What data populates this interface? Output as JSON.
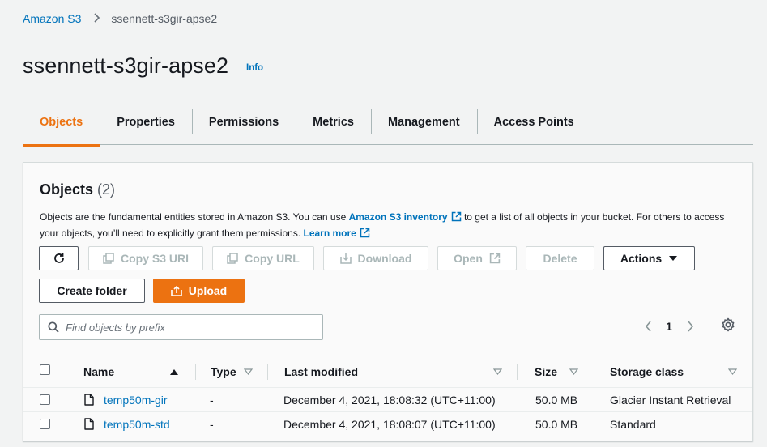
{
  "breadcrumb": {
    "root": "Amazon S3",
    "separator": ">",
    "current": "ssennett-s3gir-apse2"
  },
  "page": {
    "title": "ssennett-s3gir-apse2",
    "info_label": "Info"
  },
  "tabs": [
    {
      "label": "Objects",
      "active": true
    },
    {
      "label": "Properties",
      "active": false
    },
    {
      "label": "Permissions",
      "active": false
    },
    {
      "label": "Metrics",
      "active": false
    },
    {
      "label": "Management",
      "active": false
    },
    {
      "label": "Access Points",
      "active": false
    }
  ],
  "objects_panel": {
    "title": "Objects",
    "count": "(2)",
    "desc_part1": "Objects are the fundamental entities stored in Amazon S3. You can use ",
    "inventory_link": "Amazon S3 inventory",
    "desc_part2": " to get a list of all objects in your bucket. For others to access your objects, you’ll need to explicitly grant them permissions. ",
    "learn_more_link": "Learn more"
  },
  "toolbar": {
    "copy_s3_uri": "Copy S3 URI",
    "copy_url": "Copy URL",
    "download": "Download",
    "open": "Open",
    "delete": "Delete",
    "actions": "Actions",
    "create_folder": "Create folder",
    "upload": "Upload"
  },
  "search": {
    "placeholder": "Find objects by prefix",
    "value": ""
  },
  "pagination": {
    "current_page": "1"
  },
  "table": {
    "columns": {
      "name": "Name",
      "type": "Type",
      "last_modified": "Last modified",
      "size": "Size",
      "storage_class": "Storage class"
    },
    "rows": [
      {
        "name": "temp50m-gir",
        "type": "-",
        "last_modified": "December 4, 2021, 18:08:32 (UTC+11:00)",
        "size": "50.0 MB",
        "storage_class": "Glacier Instant Retrieval"
      },
      {
        "name": "temp50m-std",
        "type": "-",
        "last_modified": "December 4, 2021, 18:08:07 (UTC+11:00)",
        "size": "50.0 MB",
        "storage_class": "Standard"
      }
    ]
  },
  "colors": {
    "accent": "#ec7211",
    "link": "#0073bb",
    "text": "#16191f",
    "disabled": "#aab7b8",
    "background": "#f2f3f3"
  },
  "icons": [
    "chevron-right-icon",
    "external-link-icon",
    "refresh-icon",
    "copy-icon",
    "download-icon",
    "upload-icon",
    "caret-down-icon",
    "search-icon",
    "chevron-left-icon",
    "gear-icon",
    "sort-ascending-icon",
    "sort-descending-icon",
    "file-icon"
  ]
}
